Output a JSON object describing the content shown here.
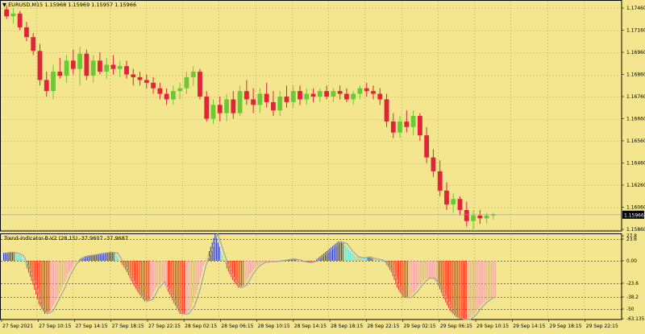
{
  "main_chart": {
    "symbol_label": "EURUSD,M15",
    "ohlc_text": "1.15968 1.15969 1.15957 1.15966",
    "current_price": "1.15966",
    "price_ticks": [
      "1.17460",
      "1.17160",
      "1.16960",
      "1.16860",
      "1.16760",
      "1.16660",
      "1.16560",
      "1.16460",
      "1.16260",
      "1.16060",
      "1.15860"
    ]
  },
  "indicator": {
    "label": "Trend-Indicator-B-V2 (28,15) -37.9607 -37.9687",
    "ticks": [
      "27.8",
      "23.6",
      "0.00",
      "-23.6",
      "-38.2",
      "-50",
      "-63.1351"
    ],
    "series": [
      {
        "name": "Trend-Indicator-B-V2",
        "values": [
          8,
          9,
          8,
          5,
          -8,
          -25,
          -45,
          -55,
          -52,
          -40,
          -28,
          -14,
          -3,
          2,
          5,
          6,
          7,
          8,
          9,
          8,
          -2,
          -12,
          -24,
          -34,
          -42,
          -40,
          -28,
          -22,
          -32,
          -44,
          -55,
          -55,
          -48,
          -30,
          -5,
          10,
          28,
          10,
          -8,
          -20,
          -28,
          -25,
          -14,
          -6,
          -2,
          -1,
          -1,
          0,
          1,
          2,
          1,
          -1,
          -2,
          0,
          5,
          10,
          15,
          20,
          18,
          10,
          4,
          3,
          4,
          2,
          1,
          -2,
          -12,
          -28,
          -38,
          -38,
          -32,
          -24,
          -18,
          -18,
          -26,
          -40,
          -52,
          -58,
          -61,
          -61,
          -56,
          -48,
          -42,
          -38
        ]
      }
    ]
  },
  "time_axis": {
    "labels": [
      "27 Sep 2021",
      "27 Sep 10:15",
      "27 Sep 14:15",
      "27 Sep 18:15",
      "27 Sep 22:15",
      "28 Sep 02:15",
      "28 Sep 06:15",
      "28 Sep 10:15",
      "28 Sep 14:15",
      "28 Sep 18:15",
      "28 Sep 22:15",
      "29 Sep 02:15",
      "29 Sep 06:15",
      "29 Sep 10:15",
      "29 Sep 14:15",
      "29 Sep 18:15",
      "29 Sep 22:15"
    ]
  },
  "chart_data": {
    "type": "candlestick",
    "ylim": [
      1.1586,
      1.1752
    ],
    "ohlc": [
      [
        1.1745,
        1.1748,
        1.1738,
        1.174
      ],
      [
        1.174,
        1.1746,
        1.1735,
        1.1742
      ],
      [
        1.1742,
        1.1744,
        1.173,
        1.1732
      ],
      [
        1.1732,
        1.1736,
        1.1722,
        1.1725
      ],
      [
        1.1725,
        1.1728,
        1.1712,
        1.1715
      ],
      [
        1.1715,
        1.172,
        1.169,
        1.1694
      ],
      [
        1.1694,
        1.17,
        1.1682,
        1.1686
      ],
      [
        1.1686,
        1.1705,
        1.168,
        1.17
      ],
      [
        1.17,
        1.171,
        1.1695,
        1.1697
      ],
      [
        1.1697,
        1.1712,
        1.1692,
        1.1708
      ],
      [
        1.1708,
        1.1716,
        1.1698,
        1.1702
      ],
      [
        1.1702,
        1.1718,
        1.169,
        1.1713
      ],
      [
        1.1713,
        1.1716,
        1.1694,
        1.1697
      ],
      [
        1.1697,
        1.1712,
        1.1692,
        1.1708
      ],
      [
        1.1708,
        1.1714,
        1.1698,
        1.17
      ],
      [
        1.17,
        1.171,
        1.1695,
        1.1705
      ],
      [
        1.1705,
        1.1712,
        1.1698,
        1.1702
      ],
      [
        1.1702,
        1.1708,
        1.1696,
        1.1704
      ],
      [
        1.1704,
        1.1708,
        1.1695,
        1.1698
      ],
      [
        1.1698,
        1.1702,
        1.169,
        1.1696
      ],
      [
        1.1696,
        1.17,
        1.169,
        1.1694
      ],
      [
        1.1694,
        1.1698,
        1.1688,
        1.1692
      ],
      [
        1.1692,
        1.1696,
        1.1684,
        1.1688
      ],
      [
        1.1688,
        1.1692,
        1.168,
        1.1684
      ],
      [
        1.1684,
        1.1688,
        1.1676,
        1.168
      ],
      [
        1.168,
        1.169,
        1.1676,
        1.1686
      ],
      [
        1.1686,
        1.1692,
        1.168,
        1.1688
      ],
      [
        1.1688,
        1.17,
        1.1684,
        1.1696
      ],
      [
        1.1696,
        1.1704,
        1.169,
        1.17
      ],
      [
        1.17,
        1.1702,
        1.168,
        1.1682
      ],
      [
        1.1682,
        1.1686,
        1.1664,
        1.1666
      ],
      [
        1.1666,
        1.168,
        1.1662,
        1.1676
      ],
      [
        1.1676,
        1.1682,
        1.1664,
        1.167
      ],
      [
        1.167,
        1.1684,
        1.1664,
        1.168
      ],
      [
        1.168,
        1.1686,
        1.1666,
        1.167
      ],
      [
        1.167,
        1.169,
        1.1668,
        1.1686
      ],
      [
        1.1686,
        1.1694,
        1.1676,
        1.168
      ],
      [
        1.168,
        1.1688,
        1.167,
        1.1676
      ],
      [
        1.1676,
        1.1688,
        1.167,
        1.1684
      ],
      [
        1.1684,
        1.1692,
        1.1674,
        1.1678
      ],
      [
        1.1678,
        1.1686,
        1.1668,
        1.1672
      ],
      [
        1.1672,
        1.1686,
        1.1668,
        1.1682
      ],
      [
        1.1682,
        1.169,
        1.1674,
        1.1678
      ],
      [
        1.1678,
        1.169,
        1.1674,
        1.1686
      ],
      [
        1.1686,
        1.169,
        1.1676,
        1.168
      ],
      [
        1.168,
        1.1688,
        1.1676,
        1.1684
      ],
      [
        1.1684,
        1.1688,
        1.1678,
        1.1682
      ],
      [
        1.1682,
        1.1688,
        1.1678,
        1.1686
      ],
      [
        1.1686,
        1.169,
        1.168,
        1.1682
      ],
      [
        1.1682,
        1.1688,
        1.1678,
        1.1686
      ],
      [
        1.1686,
        1.169,
        1.168,
        1.1684
      ],
      [
        1.1684,
        1.1688,
        1.1678,
        1.168
      ],
      [
        1.168,
        1.1686,
        1.1676,
        1.1684
      ],
      [
        1.1684,
        1.169,
        1.168,
        1.1688
      ],
      [
        1.1688,
        1.1692,
        1.1682,
        1.1686
      ],
      [
        1.1686,
        1.169,
        1.168,
        1.1684
      ],
      [
        1.1684,
        1.1688,
        1.1676,
        1.168
      ],
      [
        1.168,
        1.1684,
        1.166,
        1.1664
      ],
      [
        1.1664,
        1.167,
        1.1652,
        1.1656
      ],
      [
        1.1656,
        1.1668,
        1.1652,
        1.1664
      ],
      [
        1.1664,
        1.1672,
        1.1656,
        1.166
      ],
      [
        1.166,
        1.1672,
        1.1654,
        1.1668
      ],
      [
        1.1668,
        1.167,
        1.165,
        1.1654
      ],
      [
        1.1654,
        1.166,
        1.1634,
        1.1638
      ],
      [
        1.1638,
        1.1644,
        1.1624,
        1.1628
      ],
      [
        1.1628,
        1.1636,
        1.161,
        1.1614
      ],
      [
        1.1614,
        1.162,
        1.16,
        1.1604
      ],
      [
        1.1604,
        1.1612,
        1.1598,
        1.1608
      ],
      [
        1.1608,
        1.161,
        1.1596,
        1.16
      ],
      [
        1.16,
        1.1606,
        1.1588,
        1.1592
      ],
      [
        1.1592,
        1.16,
        1.1586,
        1.1596
      ],
      [
        1.1596,
        1.16,
        1.159,
        1.1594
      ],
      [
        1.1594,
        1.1598,
        1.159,
        1.1596
      ],
      [
        1.1596,
        1.1598,
        1.1593,
        1.1597
      ]
    ]
  },
  "colors": {
    "background": "#f3e68f",
    "grid": "#c8b25a",
    "bull": "#6cc936",
    "bear": "#e0243a",
    "doji": "#000000",
    "hist_red": "#ff2a0f",
    "hist_pink": "#f2a2a8",
    "hist_blue": "#2232c8",
    "hist_cyan": "#62e2e0",
    "osc_line": "#9da3ab"
  }
}
